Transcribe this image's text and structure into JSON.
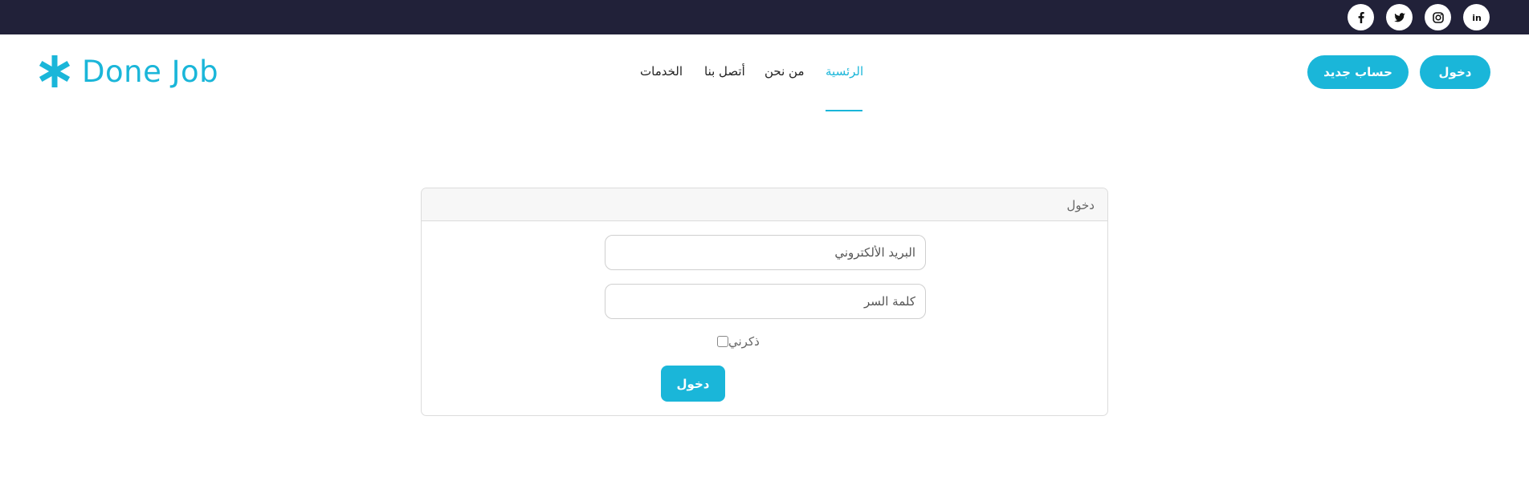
{
  "social": [
    {
      "name": "linkedin-icon",
      "glyph": "in"
    },
    {
      "name": "instagram-icon",
      "glyph": ""
    },
    {
      "name": "twitter-icon",
      "glyph": ""
    },
    {
      "name": "facebook-icon",
      "glyph": "f"
    }
  ],
  "brand": {
    "name": "Done Job",
    "color": "#1ab6d9"
  },
  "nav": {
    "home": "الرئسية",
    "about": "من نحن",
    "contact": "أتصل بنا",
    "services": "الخدمات"
  },
  "header_buttons": {
    "login": "دخول",
    "register": "حساب جديد"
  },
  "login_card": {
    "title": "دخول",
    "email_placeholder": "البريد الألكتروني",
    "password_placeholder": "كلمة السر",
    "remember_label": "ذكرني",
    "submit_label": "دخول"
  },
  "colors": {
    "topbar": "#212139",
    "accent": "#1ab6d9"
  }
}
